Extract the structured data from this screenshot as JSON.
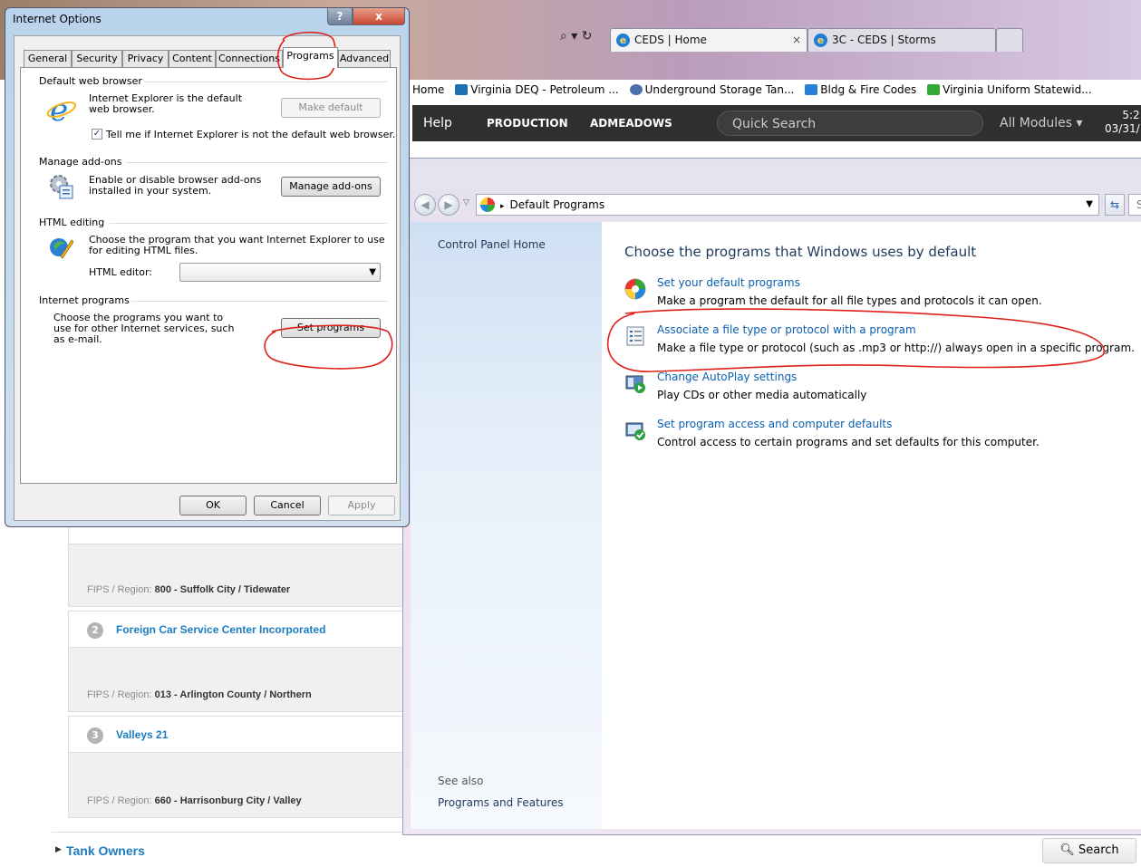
{
  "browser": {
    "tabs": [
      {
        "label": "CEDS | Home",
        "close": "×"
      },
      {
        "label": "3C - CEDS | Storms"
      }
    ],
    "search_icons": "⌕ ▾ ↻",
    "favorites": [
      {
        "label": "Home"
      },
      {
        "label": "Virginia DEQ - Petroleum ..."
      },
      {
        "label": "Underground Storage Tan..."
      },
      {
        "label": "Bldg & Fire Codes"
      },
      {
        "label": "Virginia Uniform Statewid..."
      }
    ],
    "appbar": {
      "help": "Help",
      "production": "PRODUCTION",
      "user": "ADMEADOWS",
      "quick_search": "Quick Search",
      "all_modules": "All Modules ▾",
      "time": "5:2",
      "date": "03/31/"
    }
  },
  "page": {
    "cards": [
      {
        "number": "",
        "title": "",
        "fips_label": "FIPS / Region:",
        "fips_value": "800 - Suffolk City / Tidewater"
      },
      {
        "number": "2",
        "title": "Foreign Car Service Center Incorporated",
        "fips_label": "FIPS / Region:",
        "fips_value": "013 - Arlington County / Northern"
      },
      {
        "number": "3",
        "title": "Valleys 21",
        "fips_label": "FIPS / Region:",
        "fips_value": "660 - Harrisonburg City / Valley"
      }
    ],
    "tank_owners": "Tank Owners",
    "search_button": "Search"
  },
  "default_programs": {
    "address": "Default Programs",
    "search_placeholder": "Se",
    "left": {
      "home": "Control Panel Home",
      "see_also": "See also",
      "programs_features": "Programs and Features"
    },
    "title": "Choose the programs that Windows uses by default",
    "options": [
      {
        "link": "Set your default programs",
        "desc": "Make a program the default for all file types and protocols it can open."
      },
      {
        "link": "Associate a file type or protocol with a program",
        "desc": "Make a file type or protocol (such as .mp3 or http://) always open in a specific program."
      },
      {
        "link": "Change AutoPlay settings",
        "desc": "Play CDs or other media automatically"
      },
      {
        "link": "Set program access and computer defaults",
        "desc": "Control access to certain programs and set defaults for this computer."
      }
    ]
  },
  "internet_options": {
    "title": "Internet Options",
    "help": "?",
    "close": "x",
    "tabs": [
      "General",
      "Security",
      "Privacy",
      "Content",
      "Connections",
      "Programs",
      "Advanced"
    ],
    "active_tab": "Programs",
    "default_browser": {
      "header": "Default web browser",
      "text": "Internet Explorer is the default web browser.",
      "button": "Make default",
      "checkbox_label": "Tell me if Internet Explorer is not the default web browser.",
      "checked": true
    },
    "addons": {
      "header": "Manage add-ons",
      "text": "Enable or disable browser add-ons installed in your system.",
      "button": "Manage add-ons"
    },
    "html_editing": {
      "header": "HTML editing",
      "text": "Choose the program that you want Internet Explorer to use for editing HTML files.",
      "editor_label": "HTML editor:",
      "editor_value": ""
    },
    "internet_programs": {
      "header": "Internet programs",
      "text": "Choose the programs you want to use for other Internet services, such as e-mail.",
      "button": "Set programs"
    },
    "buttons": {
      "ok": "OK",
      "cancel": "Cancel",
      "apply": "Apply"
    }
  },
  "colors": {
    "annotation": "#e0201b",
    "link": "#0b5fb0",
    "heading": "#1e395b",
    "card_title": "#1b7cc1"
  }
}
